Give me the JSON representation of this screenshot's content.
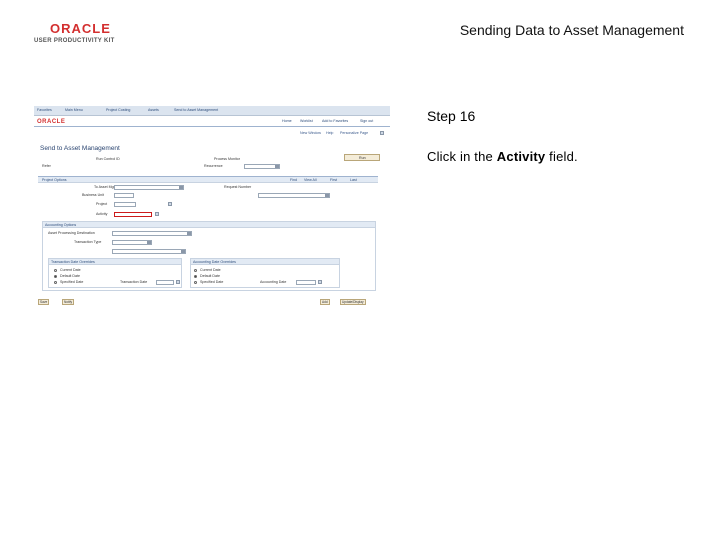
{
  "slide": {
    "logo_brand": "ORACLE",
    "logo_product": "USER PRODUCTIVITY KIT",
    "title": "Sending Data to Asset Management",
    "step": "Step 16",
    "instruction_prefix": "Click in the ",
    "instruction_bold": "Activity",
    "instruction_suffix": " field."
  },
  "screenshot": {
    "topbar_items": [
      "Favorites",
      "Main Menu",
      "Project Costing",
      "Assets",
      "Send to Asset Management"
    ],
    "brand": "ORACLE",
    "nav_items": [
      "Home",
      "Worklist",
      "Add to Favorites",
      "Sign out"
    ],
    "link_row": [
      "New Window",
      "Help",
      "Personalize Page"
    ],
    "page_heading": "Send to Asset Management",
    "fields": {
      "run_control_label": "Run Control ID",
      "business_unit_label": "Business Unit",
      "project_label": "Project",
      "activity_label": "Activity",
      "process_monitor_label": "Process Monitor",
      "run_button": "Run",
      "recurrence_label": "Recurrence",
      "request_number_label": "Request Number",
      "to_asset_mgmt_label": "To Asset Mgmt",
      "refer_label": "Refer"
    },
    "grid_head": [
      "Project Options",
      "Find",
      "View All",
      "First",
      "Last"
    ],
    "destination_label": "Asset Processing Destination",
    "transaction_type_label": "Transaction Type",
    "panels": {
      "accounting_title": "Accounting Options",
      "transaction_dates_title": "Transaction Date Overrides",
      "accounting_dates_title": "Accounting Date Overrides",
      "radio_current": "Current Date",
      "radio_default": "Default Date",
      "radio_specified": "Specified Date",
      "trans_date_label": "Transaction Date",
      "acct_date_label": "Accounting Date"
    },
    "footer_buttons": [
      "Save",
      "Notify",
      "Add",
      "Update/Display"
    ]
  },
  "colors": {
    "oracle_red": "#d32f2f",
    "highlight_red": "#cc1b1b",
    "peoplesoft_blue": "#2e4d7b"
  }
}
